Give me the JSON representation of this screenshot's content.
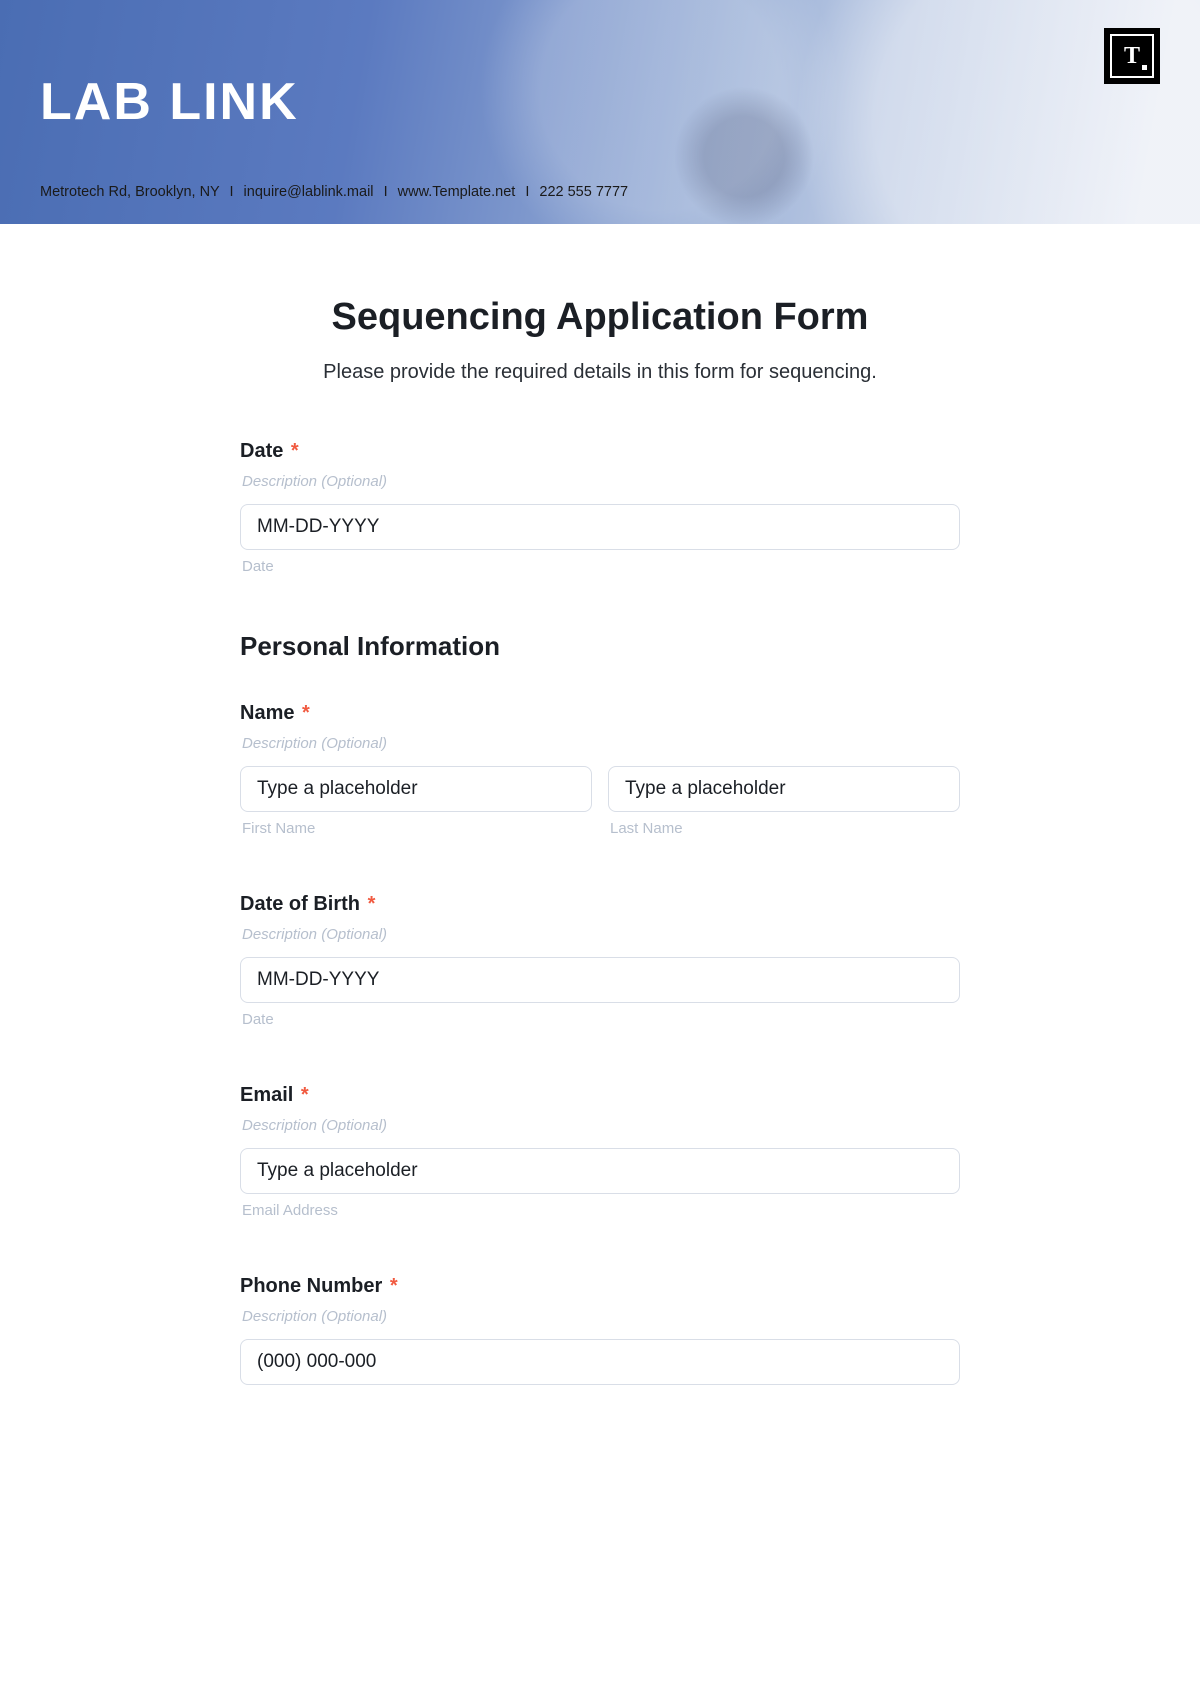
{
  "header": {
    "brand": "LAB LINK",
    "badge_letter": "T",
    "contact": {
      "address": "Metrotech Rd, Brooklyn, NY",
      "email": "inquire@lablink.mail",
      "website": "www.Template.net",
      "phone": "222 555 7777"
    }
  },
  "form": {
    "title": "Sequencing Application Form",
    "subtitle": "Please provide the required details in this form for sequencing.",
    "description_placeholder": "Description (Optional)",
    "required_mark": "*",
    "date": {
      "label": "Date",
      "placeholder": "MM-DD-YYYY",
      "sublabel": "Date"
    },
    "section_personal": "Personal Information",
    "name": {
      "label": "Name",
      "first_placeholder": "Type a placeholder",
      "first_sublabel": "First Name",
      "last_placeholder": "Type a placeholder",
      "last_sublabel": "Last Name"
    },
    "dob": {
      "label": "Date of Birth",
      "placeholder": "MM-DD-YYYY",
      "sublabel": "Date"
    },
    "email": {
      "label": "Email",
      "placeholder": "Type a placeholder",
      "sublabel": "Email Address"
    },
    "phone": {
      "label": "Phone Number",
      "placeholder": "(000) 000-000"
    }
  }
}
